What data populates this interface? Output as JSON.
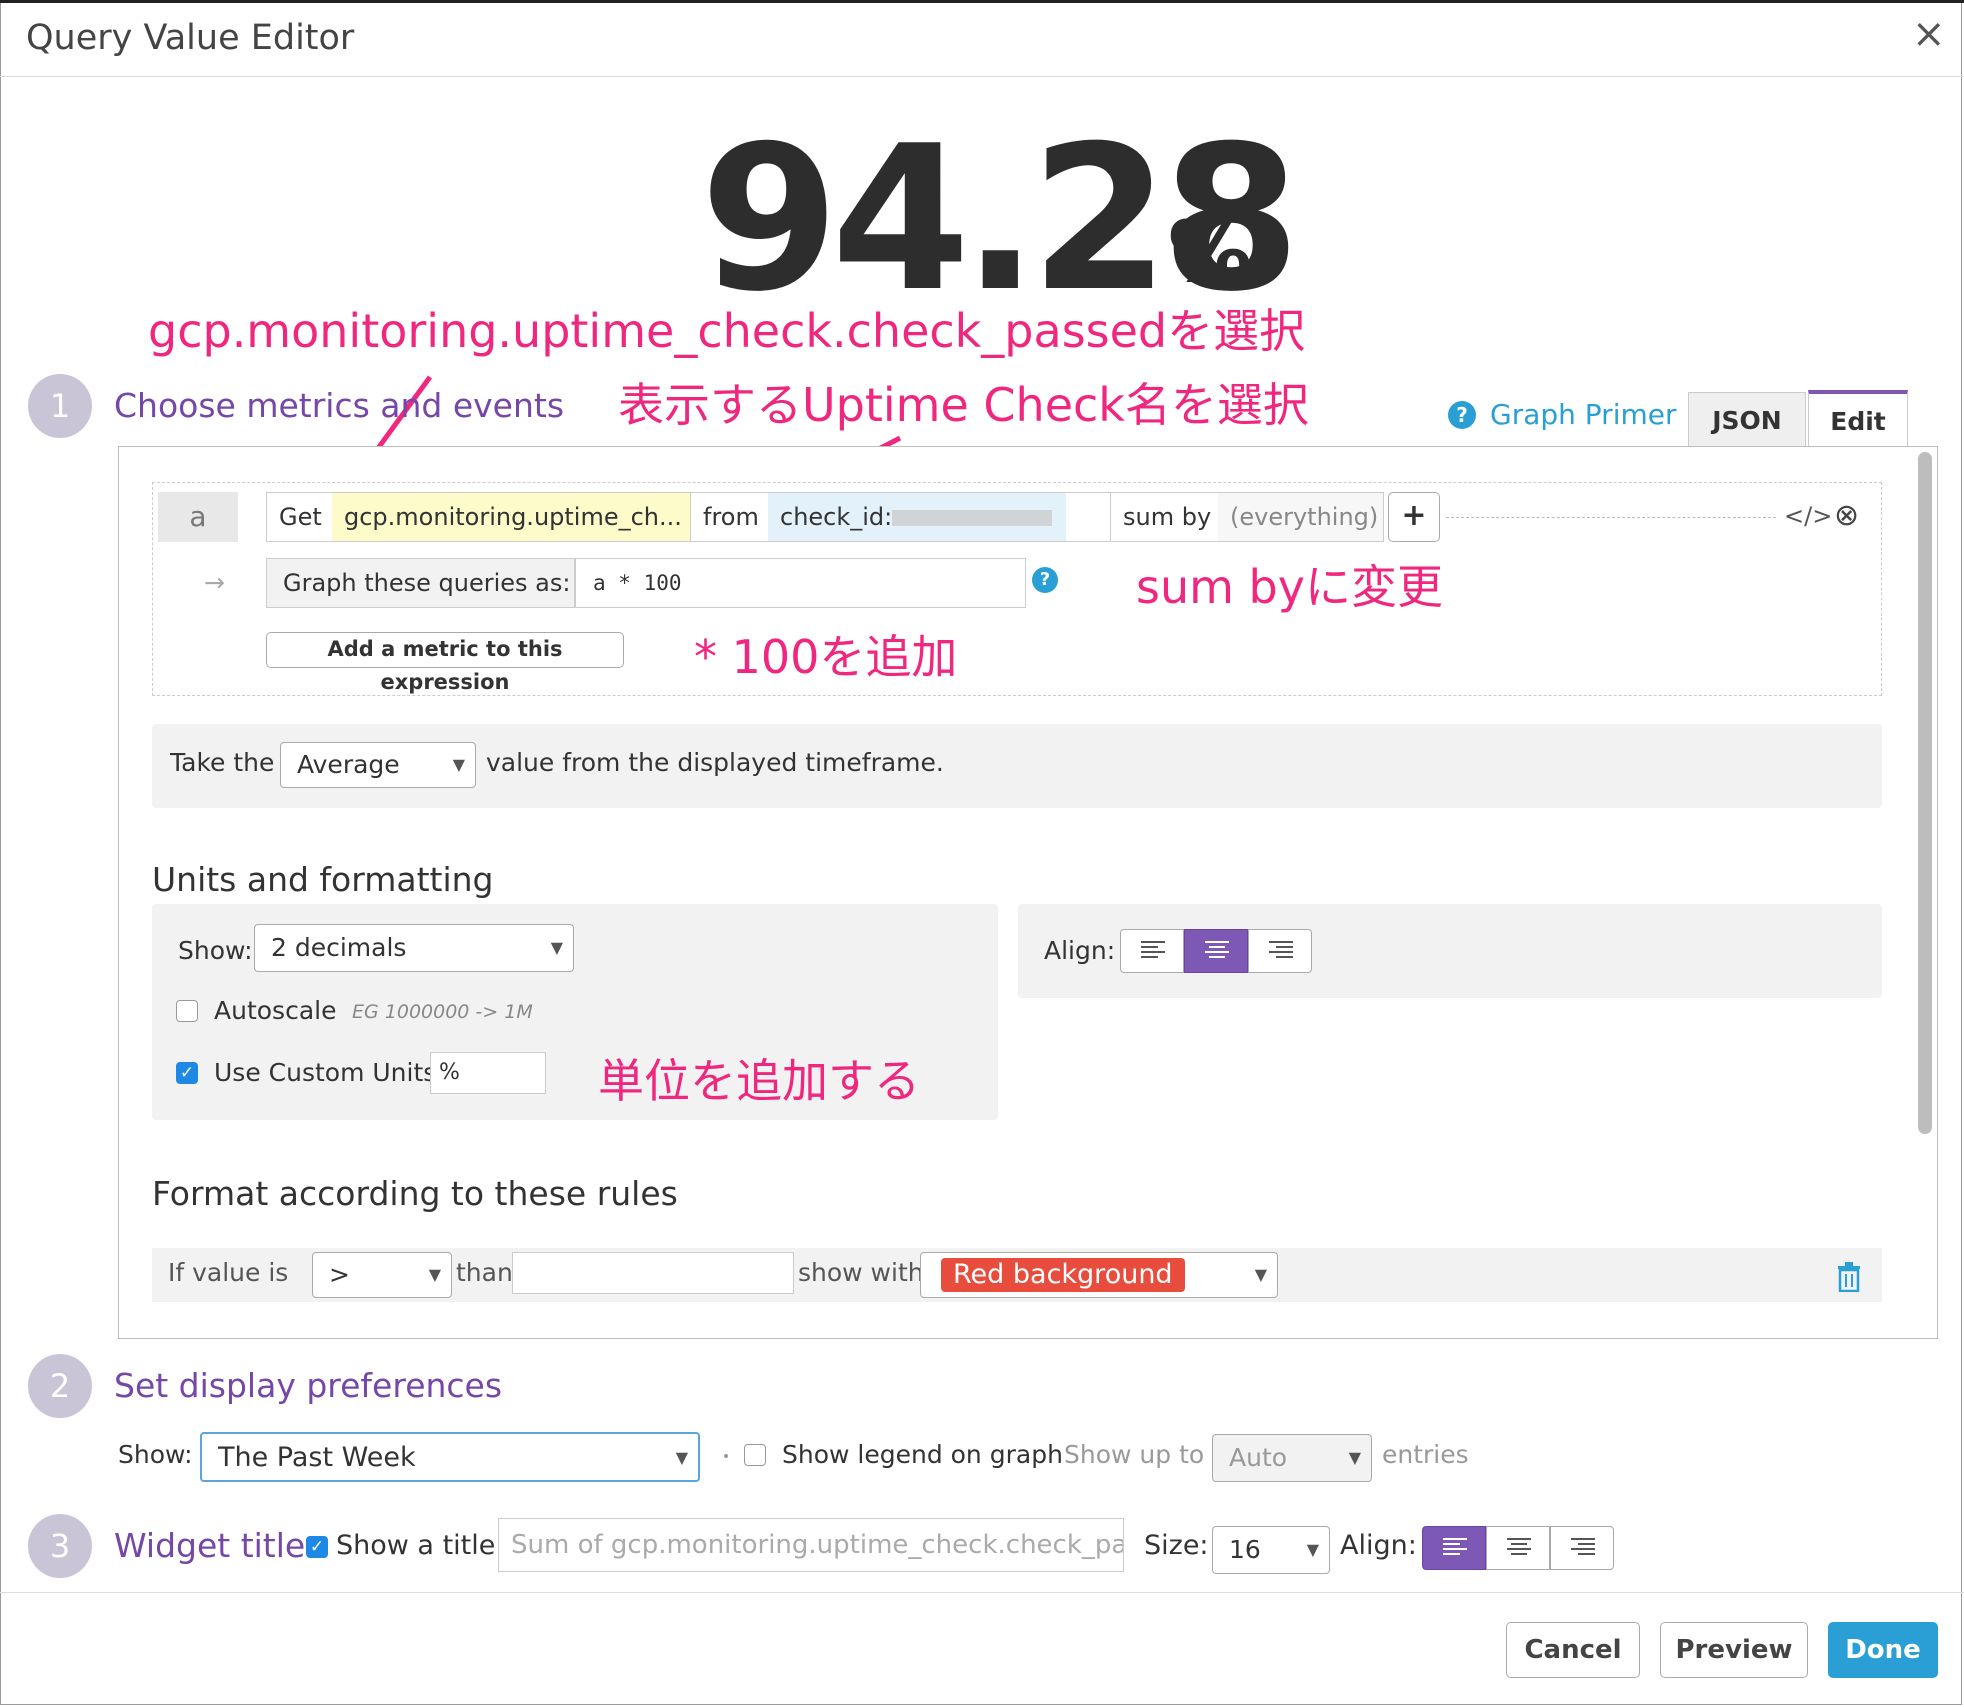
{
  "dialog": {
    "title": "Query Value Editor",
    "close_label": "×"
  },
  "preview": {
    "value": "94.28",
    "unit": "%"
  },
  "annotations": {
    "metric_note": "gcp.monitoring.uptime_check.check_passedを選択",
    "check_note": "表示するUptime Check名を選択",
    "sumby_note": "sum byに変更",
    "multiply_note": "* 100を追加",
    "unit_note": "単位を追加する"
  },
  "steps": [
    {
      "number": "1",
      "label": "Choose metrics and events"
    },
    {
      "number": "2",
      "label": "Set display preferences"
    },
    {
      "number": "3",
      "label": "Widget title"
    }
  ],
  "tabs": {
    "graph_primer": "Graph Primer",
    "json": "JSON",
    "edit": "Edit",
    "help_icon": "?"
  },
  "query": {
    "letter": "a",
    "get_label": "Get",
    "metric": "gcp.monitoring.uptime_ch...",
    "from_label": "from",
    "from_value": "check_id:",
    "sum_by_label": "sum by",
    "sum_by_value": "(everything)",
    "plus": "+",
    "code_icon": "</>",
    "remove_icon": "⊗",
    "arrow": "→",
    "graph_as_label": "Graph these queries as:",
    "expression": "a * 100",
    "add_metric_button": "Add a metric to this expression"
  },
  "timeframe": {
    "prefix": "Take the",
    "aggregation": "Average",
    "suffix": "value from the displayed timeframe."
  },
  "units": {
    "heading": "Units and formatting",
    "show_label": "Show:",
    "decimals": "2 decimals",
    "autoscale_label": "Autoscale",
    "autoscale_hint": "EG 1000000 -> 1M",
    "custom_units_label": "Use Custom Units",
    "custom_units_value": "%",
    "align_label": "Align:"
  },
  "rules": {
    "heading": "Format according to these rules",
    "if_label": "If value is",
    "comparator": ">",
    "than_label": "than",
    "threshold_value": "",
    "show_with_label": "show with",
    "style": "Red background"
  },
  "display": {
    "show_label": "Show:",
    "timeframe": "The Past Week",
    "legend_label": "Show legend on graph",
    "show_up_to_label": "Show up to",
    "entries_value": "Auto",
    "entries_label": "entries"
  },
  "widget_title": {
    "show_title_label": "Show a title:",
    "title_value": "Sum of gcp.monitoring.uptime_check.check_pa",
    "size_label": "Size:",
    "size_value": "16",
    "align_label": "Align:"
  },
  "footer": {
    "cancel": "Cancel",
    "preview": "Preview",
    "done": "Done"
  },
  "colors": {
    "accent": "#7e58b5",
    "annotation": "#f0277e",
    "primary": "#2a9fd6",
    "danger": "#e74c3c"
  }
}
